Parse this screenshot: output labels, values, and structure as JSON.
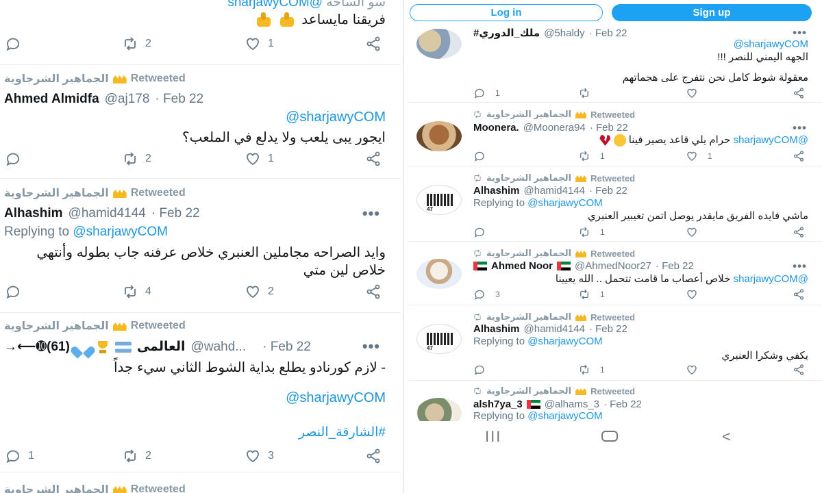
{
  "left": {
    "top_partial": {
      "text": "سو الساحه",
      "mention": "@sharjawyCOM"
    },
    "top_line": "فريقنا مايساعد",
    "top_actions": {
      "reply": "",
      "retweet": "2",
      "like": "1"
    },
    "tweets": [
      {
        "retweeted_by": "الجماهير الشرجاوية",
        "retweeted_label": "Retweeted",
        "name": "Ahmed Almidfa",
        "handle": "@aj178",
        "date": "· Feb 22",
        "mention": "@sharjawyCOM",
        "text": "ايجور يبى يلعب ولا يدلع في الملعب؟",
        "actions": {
          "reply": "",
          "retweet": "2",
          "like": "1"
        }
      },
      {
        "retweeted_by": "الجماهير الشرجاوية",
        "retweeted_label": "Retweeted",
        "name": "Alhashim",
        "handle": "@hamid4144",
        "date": "· Feb 22",
        "replying_label": "Replying to",
        "replying_to": "@sharjawyCOM",
        "text_line1": "وايد الصراحه مجاملين العنبري خلاص عرفنه جاب بطوله وأنتهي",
        "text_line2": "خلاص لين متي",
        "actions": {
          "reply": "",
          "retweet": "4",
          "like": "2"
        }
      },
      {
        "retweeted_by": "الجماهير الشرجاوية",
        "retweeted_label": "Retweeted",
        "name_prefix": "→⟵➓(61)",
        "name": "العالمى",
        "handle": "@wahd...",
        "date": "· Feb 22",
        "text": "- لازم كورنادو يطلع بداية الشوط الثاني سيء جداً",
        "mention": "@sharjawyCOM",
        "hashtag": "#الشارقة_النصر",
        "actions": {
          "reply": "1",
          "retweet": "2",
          "like": "3"
        }
      },
      {
        "retweeted_by": "الجماهير الشرجاوية",
        "retweeted_label": "Retweeted"
      }
    ]
  },
  "right": {
    "login_label": "Log in",
    "signup_label": "Sign up",
    "tweets": [
      {
        "name": "#ملك_الدوري",
        "handle": "@5haldy",
        "date": "· Feb 22",
        "mention": "@sharjawyCOM",
        "line1": "الجهه اليمني للنصر !!!",
        "line2": "معقولة شوط كامل نحن نتفرج على هجماتهم",
        "actions": {
          "reply": "1",
          "retweet": "",
          "like": ""
        }
      },
      {
        "retweeted_by": "الجماهير الشرجاوية",
        "retweeted_label": "Retweeted",
        "name": "Moonera.",
        "handle": "@Moonera94",
        "date": "· Feb 22",
        "mention": "@sharjawyCOM",
        "text": "حرام يلي قاعد يصير فينا",
        "actions": {
          "reply": "",
          "retweet": "1",
          "like": "1"
        }
      },
      {
        "retweeted_by": "الجماهير الشرجاوية",
        "retweeted_label": "Retweeted",
        "name": "Alhashim",
        "handle": "@hamid4144",
        "date": "· Feb 22",
        "replying_label": "Replying to",
        "replying_to": "@sharjawyCOM",
        "text": "ماشي فايده الفريق مايقدر يوصل اتمن تغيبير العنبري",
        "actions": {
          "reply": "",
          "retweet": "1",
          "like": ""
        }
      },
      {
        "retweeted_by": "الجماهير الشرجاوية",
        "retweeted_label": "Retweeted",
        "name": "Ahmed Noor",
        "handle": "@AhmedNoor27",
        "date": "· Feb 22",
        "mention": "@sharjawyCOM",
        "text": "خلاص أعصاب ما قامت تتحمل .. الله يعيينا",
        "actions": {
          "reply": "3",
          "retweet": "1",
          "like": ""
        }
      },
      {
        "retweeted_by": "الجماهير الشرجاوية",
        "retweeted_label": "Retweeted",
        "name": "Alhashim",
        "handle": "@hamid4144",
        "date": "· Feb 22",
        "replying_label": "Replying to",
        "replying_to": "@sharjawyCOM",
        "text": "يكفي وشكرا العنبري",
        "actions": {
          "reply": "",
          "retweet": "1",
          "like": ""
        }
      },
      {
        "retweeted_by": "الجماهير الشرجاوية",
        "retweeted_label": "Retweeted",
        "name": "alsh7ya_3",
        "handle": "@alhams_3",
        "date": "· Feb 22",
        "replying_label": "Replying to",
        "replying_to": "@sharjawyCOM"
      }
    ],
    "nav": {
      "recents": "III",
      "back": "<"
    },
    "avatar_logo_text": "47"
  },
  "colors": {
    "accent": "#1da1f2",
    "mention": "#1b95e0",
    "muted": "#657786",
    "divider": "#e6ecf0"
  },
  "icons": [
    "reply-icon",
    "retweet-icon",
    "like-icon",
    "share-icon",
    "crown-icon",
    "thumbs-down-icon",
    "uae-flag-icon",
    "argentina-flag-icon",
    "trophy-icon",
    "blue-heart-icon",
    "relieved-face-icon",
    "broken-heart-icon"
  ]
}
